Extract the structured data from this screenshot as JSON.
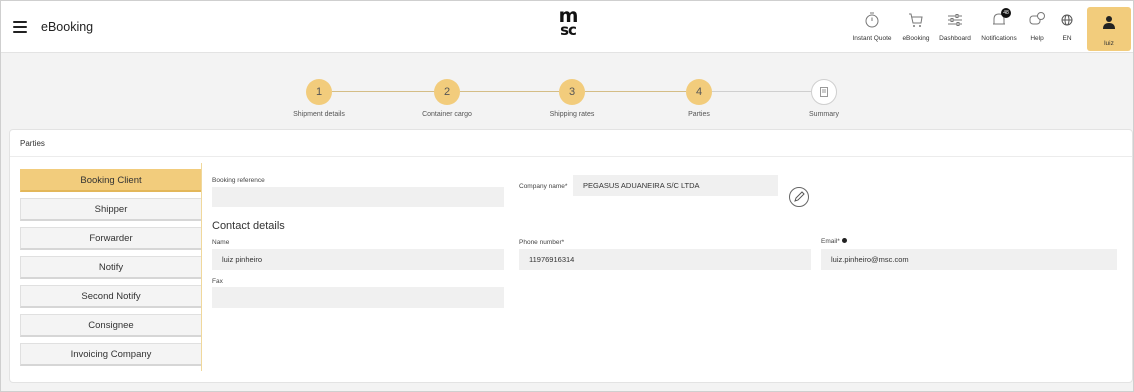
{
  "header": {
    "app_title": "eBooking",
    "logo_top": "m",
    "logo_bottom": "sc",
    "nav": [
      {
        "label": "Instant Quote",
        "icon": "stopwatch-icon"
      },
      {
        "label": "eBooking",
        "icon": "cart-icon"
      },
      {
        "label": "Dashboard",
        "icon": "sliders-icon"
      },
      {
        "label": "Notifications",
        "icon": "bell-icon",
        "badge": "48"
      },
      {
        "label": "Help",
        "icon": "help-chat-icon"
      },
      {
        "label": "EN",
        "icon": "globe-icon"
      }
    ],
    "user_label": "luiz",
    "accent": "#f2cc7c"
  },
  "stepper": {
    "steps": [
      {
        "number": "1",
        "label": "Shipment details"
      },
      {
        "number": "2",
        "label": "Container cargo"
      },
      {
        "number": "3",
        "label": "Shipping rates"
      },
      {
        "number": "4",
        "label": "Parties"
      },
      {
        "number": "",
        "label": "Summary",
        "icon": "document-icon"
      }
    ]
  },
  "parties": {
    "title": "Parties",
    "tabs": [
      "Booking Client",
      "Shipper",
      "Forwarder",
      "Notify",
      "Second Notify",
      "Consignee",
      "Invoicing Company"
    ],
    "active_tab": "Booking Client",
    "booking_reference": {
      "label": "Booking reference",
      "value": ""
    },
    "company_name": {
      "label": "Company name*",
      "value": "PEGASUS ADUANEIRA S/C LTDA"
    },
    "contact_details_title": "Contact details",
    "name": {
      "label": "Name",
      "value": "luiz pinheiro"
    },
    "phone": {
      "label": "Phone number*",
      "value": "11976916314"
    },
    "email": {
      "label": "Email*",
      "value": "luiz.pinheiro@msc.com"
    },
    "fax": {
      "label": "Fax",
      "value": ""
    }
  }
}
